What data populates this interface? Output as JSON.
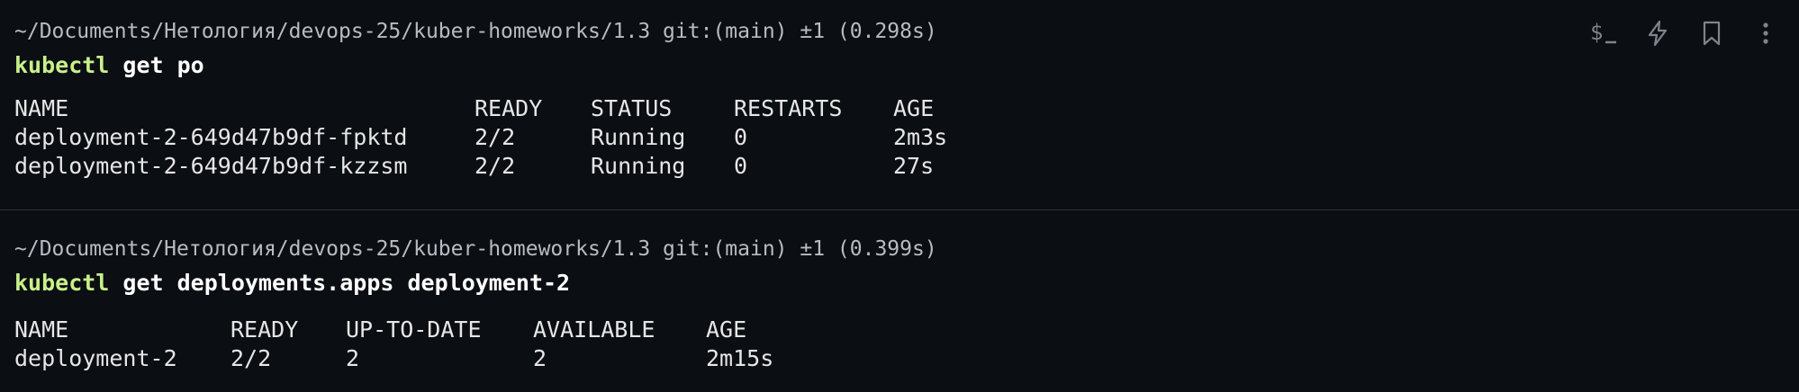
{
  "toolbar": {
    "buttons": [
      {
        "name": "terminal-icon"
      },
      {
        "name": "bolt-icon"
      },
      {
        "name": "bookmark-icon"
      },
      {
        "name": "more-options-icon"
      }
    ]
  },
  "blocks": [
    {
      "header": "~/Documents/Нетология/devops-25/kuber-homeworks/1.3 git:(main) ±1 (0.298s)",
      "command": {
        "program": "kubectl",
        "args": " get po"
      },
      "table": {
        "columns": [
          "NAME",
          "READY",
          "STATUS",
          "RESTARTS",
          "AGE"
        ],
        "rows": [
          [
            "deployment-2-649d47b9df-fpktd",
            "2/2",
            "Running",
            "0",
            "2m3s"
          ],
          [
            "deployment-2-649d47b9df-kzzsm",
            "2/2",
            "Running",
            "0",
            "27s"
          ]
        ]
      }
    },
    {
      "header": "~/Documents/Нетология/devops-25/kuber-homeworks/1.3 git:(main) ±1 (0.399s)",
      "command": {
        "program": "kubectl",
        "args": " get deployments.apps deployment-2"
      },
      "table": {
        "columns": [
          "NAME",
          "READY",
          "UP-TO-DATE",
          "AVAILABLE",
          "AGE"
        ],
        "rows": [
          [
            "deployment-2",
            "2/2",
            "2",
            "2",
            "2m15s"
          ]
        ]
      }
    }
  ],
  "colors": {
    "background": "#0b0e13",
    "command_highlight": "#c8f08a",
    "header_text": "#b8bcc2",
    "icon": "#7f848c"
  }
}
